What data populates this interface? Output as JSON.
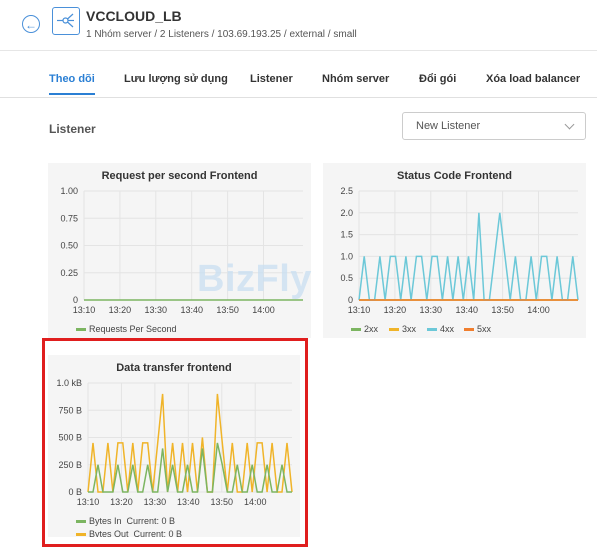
{
  "header": {
    "title": "VCCLOUD_LB",
    "subtitle": "1 Nhóm server / 2 Listeners / 103.69.193.25 / external / small"
  },
  "tabs": [
    {
      "label": "Theo dõi"
    },
    {
      "label": "Lưu lượng sử dụng"
    },
    {
      "label": "Listener"
    },
    {
      "label": "Nhóm server"
    },
    {
      "label": "Đổi gói"
    },
    {
      "label": "Xóa load balancer"
    }
  ],
  "section": {
    "title": "Listener"
  },
  "listener_select": {
    "value": "New Listener"
  },
  "watermark": "BizFly",
  "chart_data": [
    {
      "type": "line",
      "title": "Request per second Frontend",
      "x": [
        "13:10",
        "13:20",
        "13:30",
        "13:40",
        "13:50",
        "14:00"
      ],
      "yticks": [
        "1.00",
        "0.75",
        "0.50",
        "0.25",
        "0"
      ],
      "ylim": [
        0,
        1
      ],
      "series": [
        {
          "name": "Requests Per Second",
          "color": "#7cb561",
          "values": [
            0,
            0,
            0,
            0,
            0,
            0,
            0
          ]
        }
      ],
      "grid": true,
      "legend": "bottom-left"
    },
    {
      "type": "line",
      "title": "Status Code Frontend",
      "x": [
        "13:10",
        "13:20",
        "13:30",
        "13:40",
        "13:50",
        "14:00"
      ],
      "yticks": [
        "2.5",
        "2.0",
        "1.5",
        "1.0",
        "0.5",
        "0"
      ],
      "ylim": [
        0,
        2.5
      ],
      "series": [
        {
          "name": "2xx",
          "color": "#7cb561"
        },
        {
          "name": "3xx",
          "color": "#f0b429"
        },
        {
          "name": "4xx",
          "color": "#6cc8d8"
        },
        {
          "name": "5xx",
          "color": "#f07e2e"
        }
      ],
      "series_4xx_values": [
        0,
        1,
        0,
        0,
        1,
        0,
        1,
        1,
        0,
        1,
        0,
        1,
        1,
        0,
        1,
        1,
        0,
        1,
        0,
        1,
        0,
        1,
        0,
        2,
        0,
        0,
        1,
        2,
        1,
        0,
        1,
        0,
        0,
        1,
        0,
        1,
        1,
        0,
        1,
        0,
        0,
        1,
        0
      ],
      "grid": true,
      "legend": "bottom-left"
    },
    {
      "type": "line",
      "title": "Data transfer frontend",
      "x": [
        "13:10",
        "13:20",
        "13:30",
        "13:40",
        "13:50",
        "14:00"
      ],
      "yticks": [
        "1.0 kB",
        "750 B",
        "500 B",
        "250 B",
        "0 B"
      ],
      "ylim": [
        0,
        1000
      ],
      "series": [
        {
          "name": "Bytes In",
          "current": "Current: 0 B",
          "color": "#7cb561"
        },
        {
          "name": "Bytes Out",
          "current": "Current: 0 B",
          "color": "#f0b429"
        }
      ],
      "series_out_values": [
        0,
        450,
        0,
        0,
        450,
        0,
        450,
        450,
        0,
        450,
        0,
        450,
        450,
        0,
        450,
        900,
        0,
        450,
        0,
        450,
        0,
        450,
        0,
        500,
        0,
        0,
        900,
        450,
        0,
        450,
        0,
        0,
        450,
        0,
        450,
        450,
        0,
        450,
        0,
        0,
        450,
        0
      ],
      "series_in_values": [
        0,
        0,
        250,
        0,
        0,
        0,
        250,
        0,
        0,
        250,
        0,
        0,
        250,
        0,
        0,
        400,
        0,
        250,
        0,
        0,
        250,
        0,
        0,
        400,
        0,
        0,
        450,
        250,
        0,
        0,
        250,
        0,
        0,
        250,
        0,
        0,
        250,
        0,
        0,
        250,
        0,
        0
      ],
      "grid": true,
      "legend": "bottom-left"
    }
  ]
}
